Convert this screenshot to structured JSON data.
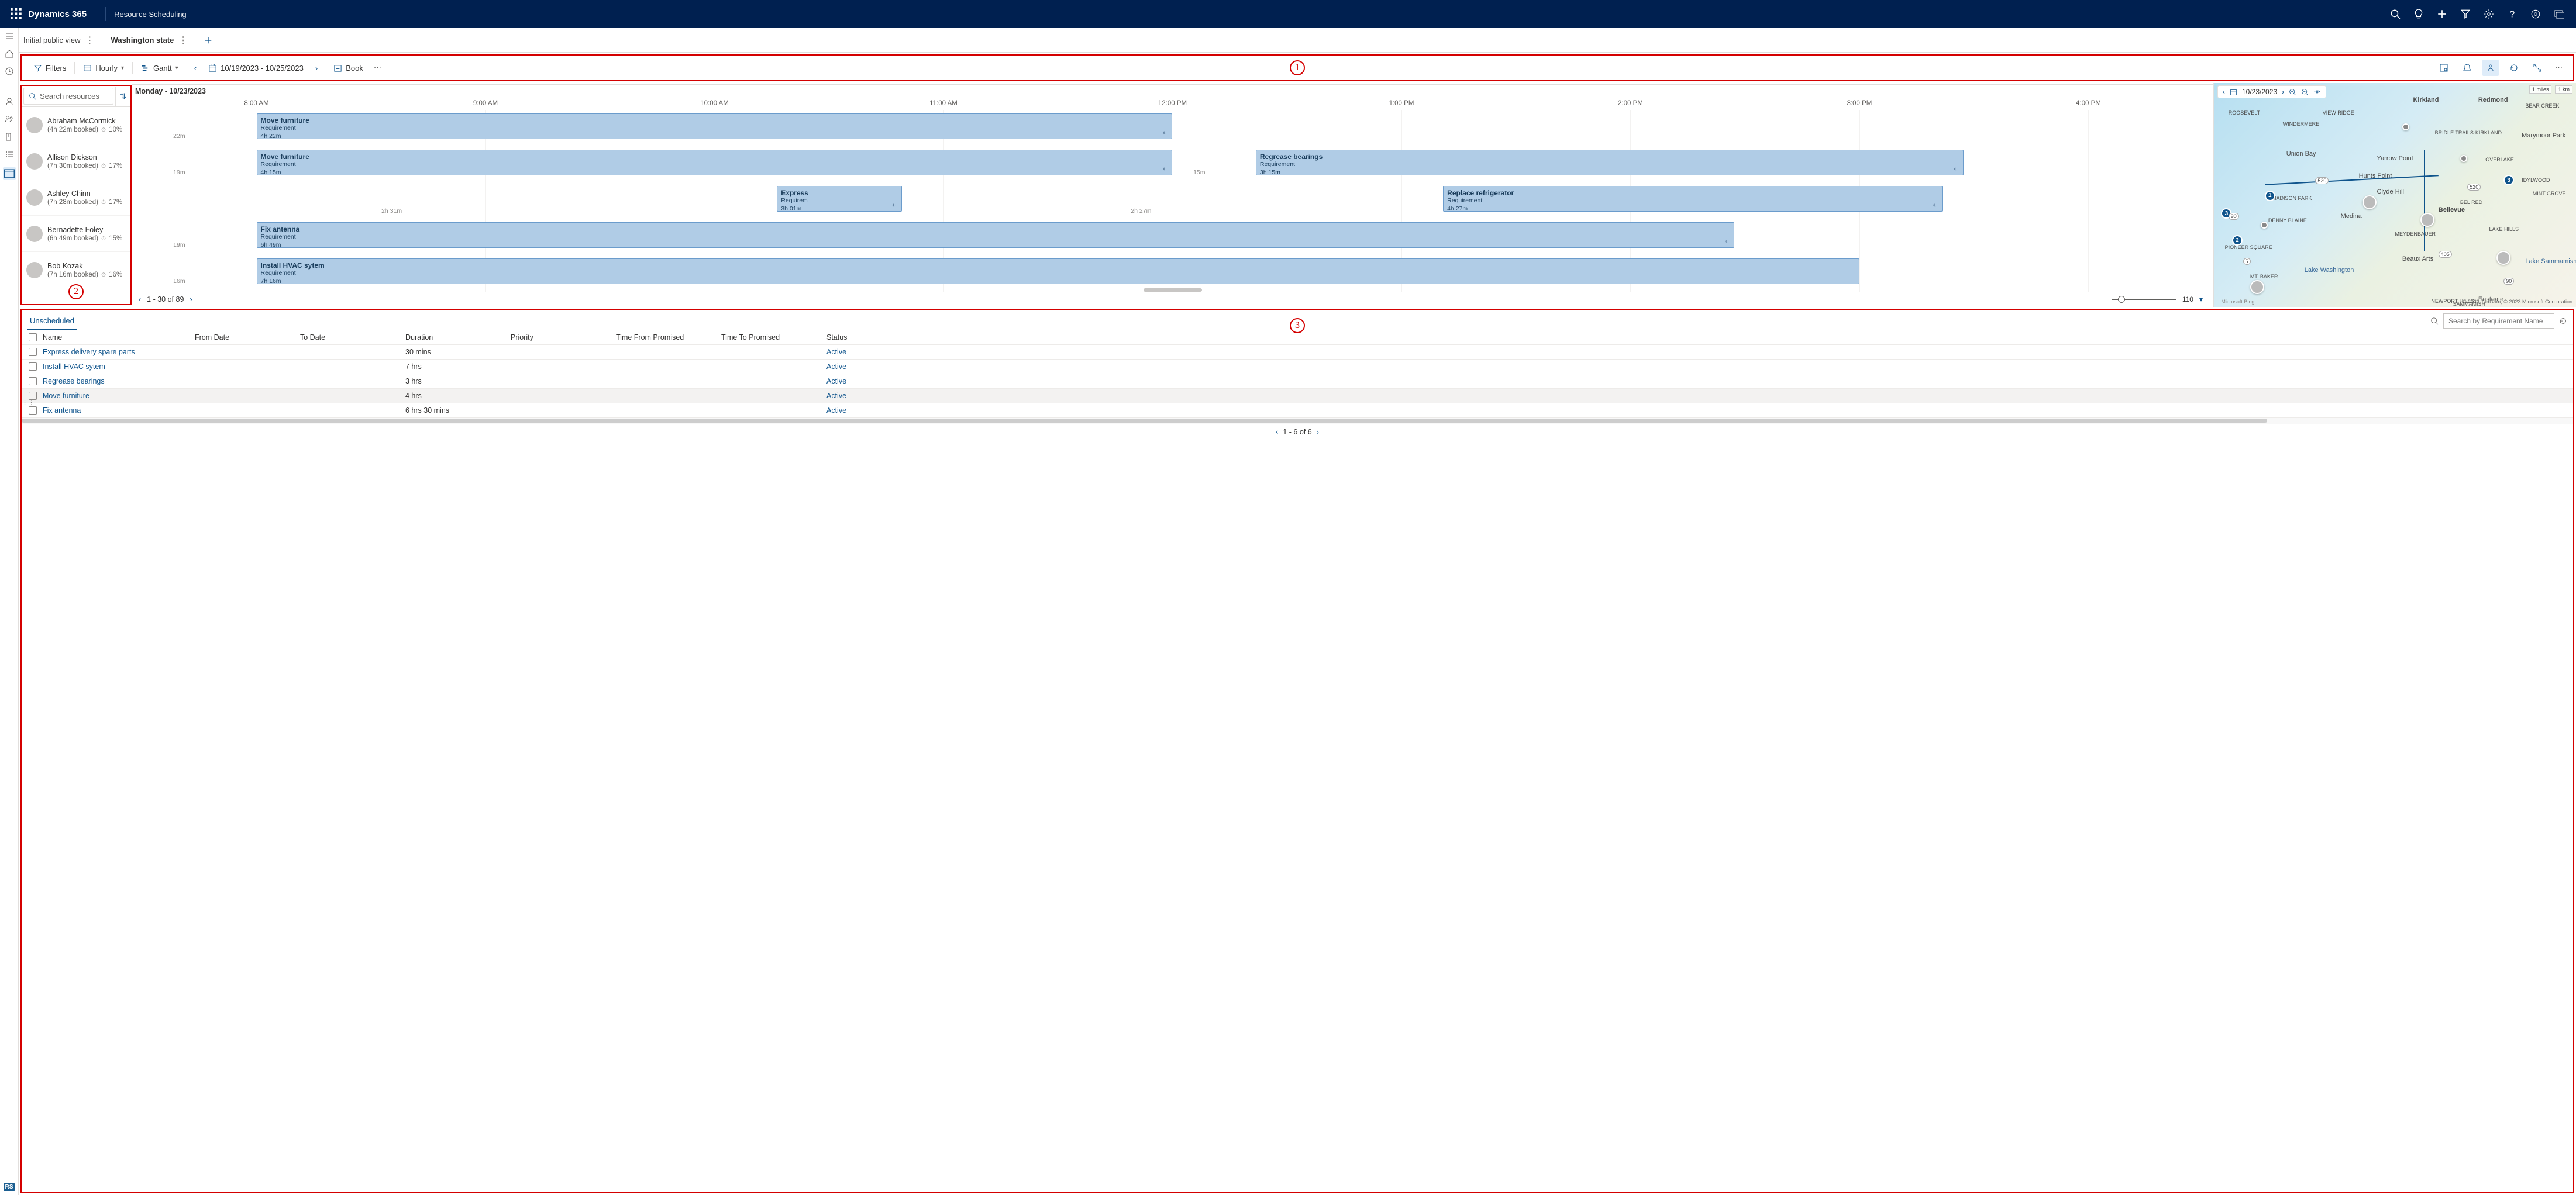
{
  "header": {
    "product": "Dynamics 365",
    "area": "Resource Scheduling"
  },
  "views": {
    "public": "Initial public view",
    "current": "Washington state"
  },
  "annotations": {
    "a1": "1",
    "a2": "2",
    "a3": "3"
  },
  "toolbar": {
    "filters": "Filters",
    "hourly": "Hourly",
    "gantt": "Gantt",
    "date_range": "10/19/2023 - 10/25/2023",
    "book": "Book"
  },
  "resource_panel": {
    "search_placeholder": "Search resources",
    "pager": "1 - 30 of 89",
    "rows": [
      {
        "name": "Abraham McCormick",
        "sub": "(4h 22m booked)",
        "pct": "10%"
      },
      {
        "name": "Allison Dickson",
        "sub": "(7h 30m booked)",
        "pct": "17%"
      },
      {
        "name": "Ashley Chinn",
        "sub": "(7h 28m booked)",
        "pct": "17%"
      },
      {
        "name": "Bernadette Foley",
        "sub": "(6h 49m booked)",
        "pct": "15%"
      },
      {
        "name": "Bob Kozak",
        "sub": "(7h 16m booked)",
        "pct": "16%"
      }
    ]
  },
  "gantt": {
    "day_header": "Monday - 10/23/2023",
    "hours": [
      "8:00 AM",
      "9:00 AM",
      "10:00 AM",
      "11:00 AM",
      "12:00 PM",
      "1:00 PM",
      "2:00 PM",
      "3:00 PM",
      "4:00 PM"
    ],
    "zoom_value": "110",
    "travel": {
      "r0": "22m",
      "r1": "19m",
      "r1b": "15m",
      "r2_gap1": "2h 31m",
      "r2_gap2": "2h 27m",
      "r3": "19m",
      "r4": "16m"
    },
    "bookings": {
      "r0": {
        "title": "Move furniture",
        "sub1": "Requirement",
        "sub2": "4h 22m"
      },
      "r1a": {
        "title": "Move furniture",
        "sub1": "Requirement",
        "sub2": "4h 15m"
      },
      "r1b": {
        "title": "Regrease bearings",
        "sub1": "Requirement",
        "sub2": "3h 15m"
      },
      "r2a": {
        "title": "Express",
        "sub1": "Requirem",
        "sub2": "3h 01m"
      },
      "r2b": {
        "title": "Replace refrigerator",
        "sub1": "Requirement",
        "sub2": "4h 27m"
      },
      "r3": {
        "title": "Fix antenna",
        "sub1": "Requirement",
        "sub2": "6h 49m"
      },
      "r4": {
        "title": "Install HVAC sytem",
        "sub1": "Requirement",
        "sub2": "7h 16m"
      }
    }
  },
  "map": {
    "date": "10/23/2023",
    "scale_mi": "1 miles",
    "scale_km": "1 km",
    "credits": "© 2023 TomTom, © 2023 Microsoft Corporation",
    "bing": "Microsoft Bing",
    "labels": {
      "kirkland": "Kirkland",
      "redmond": "Redmond",
      "bellevue": "Bellevue",
      "yarrow": "Yarrow Point",
      "hunts": "Hunts Point",
      "clyde": "Clyde Hill",
      "medina": "Medina",
      "beaux": "Beaux Arts",
      "eastgate": "Eastgate",
      "union": "Union Bay",
      "madison": "MADISON PARK",
      "denny": "DENNY BLAINE",
      "pioneer": "PIONEER SQUARE",
      "lakesam": "Lake Sammamish",
      "newport": "NEWPORT HILLS",
      "sammamish": "SAMMAMISH",
      "lakehills": "LAKE HILLS",
      "belred": "BEL RED",
      "bridle": "BRIDLE TRAILS-KIRKLAND",
      "marymoor": "Marymoor Park",
      "wmere": "WINDERMERE",
      "mintgrove": "MINT GROVE",
      "overlake": "OVERLAKE",
      "idylwood": "IDYLWOOD",
      "bearcreek": "BEAR CREEK",
      "lakewa": "Lake Washington",
      "meyden": "MEYDENBAUER",
      "mtbaker": "MT. BAKER",
      "roosevelt": "ROOSEVELT",
      "viewridge": "VIEW RIDGE",
      "h520": "520",
      "h520b": "520",
      "h90": "90",
      "h90b": "90",
      "h405": "405",
      "h5": "5"
    }
  },
  "bottom": {
    "tab": "Unscheduled",
    "search_placeholder": "Search by Requirement Name",
    "cols": {
      "name": "Name",
      "from": "From Date",
      "to": "To Date",
      "dur": "Duration",
      "pri": "Priority",
      "tfp": "Time From Promised",
      "ttp": "Time To Promised",
      "status": "Status"
    },
    "rows": [
      {
        "name": "Express delivery spare parts",
        "dur": "30 mins",
        "status": "Active"
      },
      {
        "name": "Install HVAC sytem",
        "dur": "7 hrs",
        "status": "Active"
      },
      {
        "name": "Regrease bearings",
        "dur": "3 hrs",
        "status": "Active"
      },
      {
        "name": "Move furniture",
        "dur": "4 hrs",
        "status": "Active"
      },
      {
        "name": "Fix antenna",
        "dur": "6 hrs 30 mins",
        "status": "Active"
      }
    ],
    "pager": "1 - 6 of 6"
  },
  "rail_badge": "RS"
}
